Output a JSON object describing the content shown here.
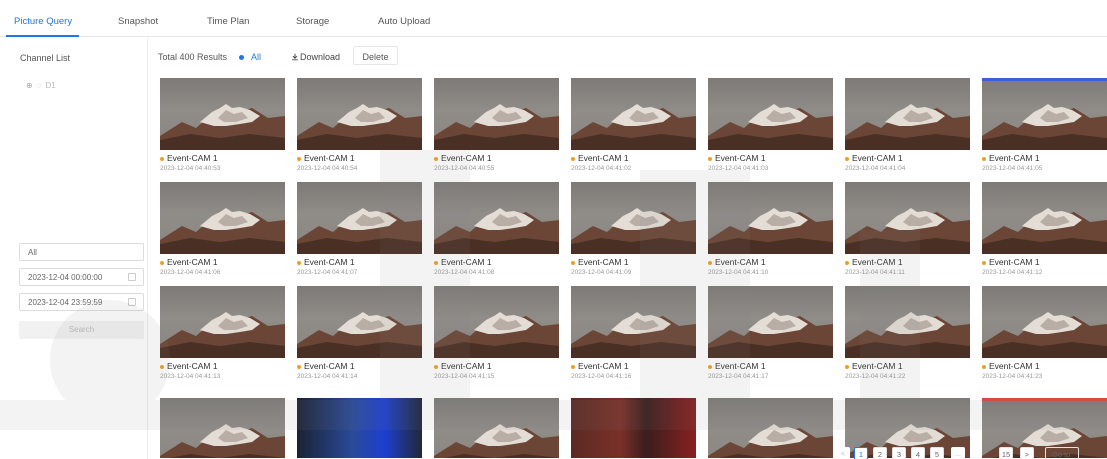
{
  "tabs": [
    {
      "label": "Picture Query",
      "active": true
    },
    {
      "label": "Snapshot",
      "active": false
    },
    {
      "label": "Time Plan",
      "active": false
    },
    {
      "label": "Storage",
      "active": false
    },
    {
      "label": "Auto Upload",
      "active": false
    }
  ],
  "left_panel": {
    "title": "Channel List",
    "tree_item": "D1",
    "type_select": "All",
    "start_time": "2023-12-04 00:00:00",
    "end_time": "2023-12-04 23:59:59",
    "search_label": "Search"
  },
  "toolbar": {
    "total": "Total 400 Results",
    "filter_all": "All",
    "download_label": "Download",
    "delete_label": "Delete"
  },
  "pictures": [
    {
      "event": "Event-CAM 1",
      "time": "2023-12-04 04:40:53"
    },
    {
      "event": "Event-CAM 1",
      "time": "2023-12-04 04:40:54"
    },
    {
      "event": "Event-CAM 1",
      "time": "2023-12-04 04:40:55"
    },
    {
      "event": "Event-CAM 1",
      "time": "2023-12-04 04:41:02"
    },
    {
      "event": "Event-CAM 1",
      "time": "2023-12-04 04:41:03"
    },
    {
      "event": "Event-CAM 1",
      "time": "2023-12-04 04:41:04"
    },
    {
      "event": "Event-CAM 1",
      "time": "2023-12-04 04:41:05"
    },
    {
      "event": "Event-CAM 1",
      "time": "2023-12-04 04:41:06"
    },
    {
      "event": "Event-CAM 1",
      "time": "2023-12-04 04:41:07"
    },
    {
      "event": "Event-CAM 1",
      "time": "2023-12-04 04:41:08"
    },
    {
      "event": "Event-CAM 1",
      "time": "2023-12-04 04:41:09"
    },
    {
      "event": "Event-CAM 1",
      "time": "2023-12-04 04:41:10"
    },
    {
      "event": "Event-CAM 1",
      "time": "2023-12-04 04:41:11"
    },
    {
      "event": "Event-CAM 1",
      "time": "2023-12-04 04:41:12"
    },
    {
      "event": "Event-CAM 1",
      "time": "2023-12-04 04:41:13"
    },
    {
      "event": "Event-CAM 1",
      "time": "2023-12-04 04:41:14"
    },
    {
      "event": "Event-CAM 1",
      "time": "2023-12-04 04:41:15"
    },
    {
      "event": "Event-CAM 1",
      "time": "2023-12-04 04:41:16"
    },
    {
      "event": "Event-CAM 1",
      "time": "2023-12-04 04:41:17"
    },
    {
      "event": "Event-CAM 1",
      "time": "2023-12-04 04:41:22"
    },
    {
      "event": "Event-CAM 1",
      "time": "2023-12-04 04:41:23"
    }
  ],
  "pagination": {
    "prev": "<",
    "pages": [
      "1",
      "2",
      "3",
      "4",
      "5"
    ],
    "ellipsis": "...",
    "last": "15",
    "next": ">",
    "goto_label": "Go to",
    "current": "1"
  },
  "colors": {
    "accent": "#1f78e0",
    "event_dot": "#f0a020"
  },
  "icons": {
    "download": "download-icon",
    "calendar": "calendar-icon",
    "camera": "camera-icon"
  }
}
